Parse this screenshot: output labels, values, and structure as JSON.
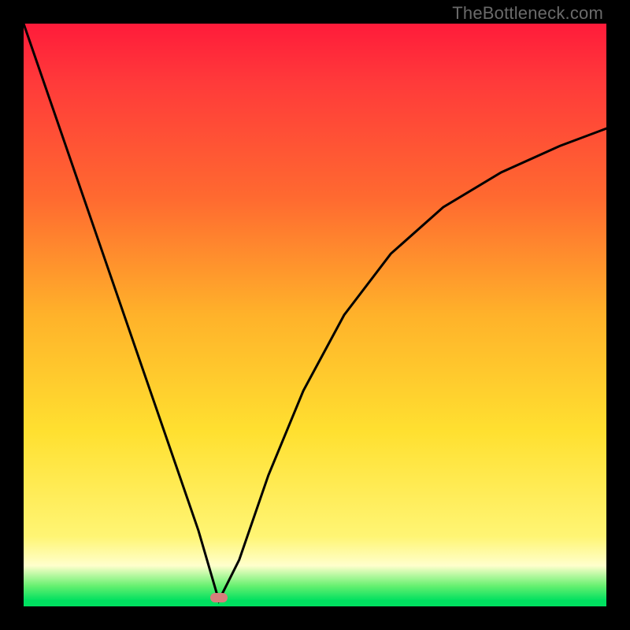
{
  "watermark_text": "TheBottleneck.com",
  "colors": {
    "frame": "#000000",
    "gradient_top": "#ff1b3a",
    "gradient_mid": "#ffe030",
    "gradient_bottom": "#00e060",
    "curve": "#000000",
    "marker": "#d67f7c"
  },
  "chart_data": {
    "type": "line",
    "title": "",
    "xlabel": "",
    "ylabel": "",
    "xlim": [
      0,
      1
    ],
    "ylim": [
      0,
      1
    ],
    "notes": "Axes are unlabeled. Values are normalized fractions of the plot area. y=1 at top, y=0 at bottom. A V-shaped curve dips to ~0 near x≈0.34 then rises with diminishing slope toward the right.",
    "series": [
      {
        "name": "bottleneck-curve",
        "x": [
          0.0,
          0.05,
          0.1,
          0.15,
          0.2,
          0.25,
          0.3,
          0.335,
          0.37,
          0.42,
          0.48,
          0.55,
          0.63,
          0.72,
          0.82,
          0.92,
          1.0
        ],
        "y": [
          1.0,
          0.855,
          0.71,
          0.565,
          0.42,
          0.275,
          0.13,
          0.01,
          0.08,
          0.225,
          0.37,
          0.5,
          0.605,
          0.685,
          0.745,
          0.79,
          0.82
        ]
      }
    ],
    "marker": {
      "x": 0.335,
      "y": 0.015
    }
  }
}
